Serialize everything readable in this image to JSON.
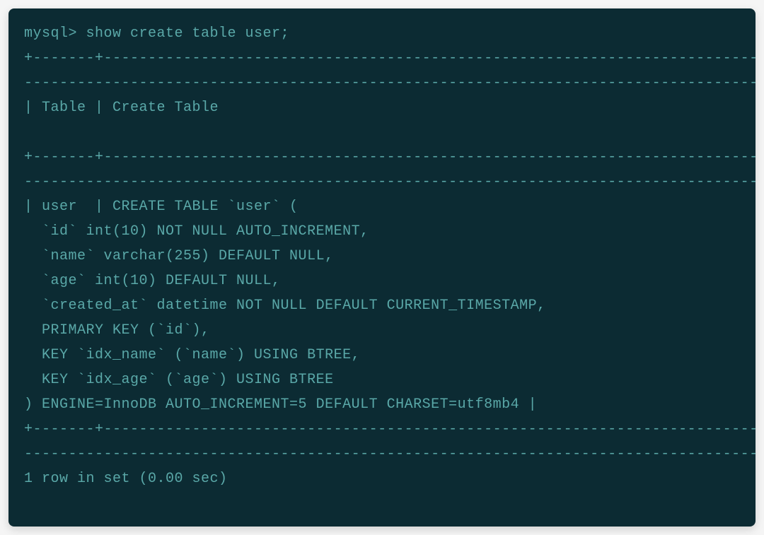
{
  "terminal": {
    "prompt": "mysql> ",
    "command": "show create table user;",
    "separator1": "+-------+-----------------------------------------------------------------------------------",
    "separator2": "-------------------------------------------------------------------------------------------",
    "header": "| Table | Create Table",
    "blank": "",
    "row_start": "| user  | CREATE TABLE `user` (",
    "col_id": "  `id` int(10) NOT NULL AUTO_INCREMENT,",
    "col_name": "  `name` varchar(255) DEFAULT NULL,",
    "col_age": "  `age` int(10) DEFAULT NULL,",
    "col_created": "  `created_at` datetime NOT NULL DEFAULT CURRENT_TIMESTAMP,",
    "pk": "  PRIMARY KEY (`id`),",
    "idx_name": "  KEY `idx_name` (`name`) USING BTREE,",
    "idx_age": "  KEY `idx_age` (`age`) USING BTREE",
    "row_end": ") ENGINE=InnoDB AUTO_INCREMENT=5 DEFAULT CHARSET=utf8mb4 |",
    "result": "1 row in set (0.00 sec)"
  }
}
